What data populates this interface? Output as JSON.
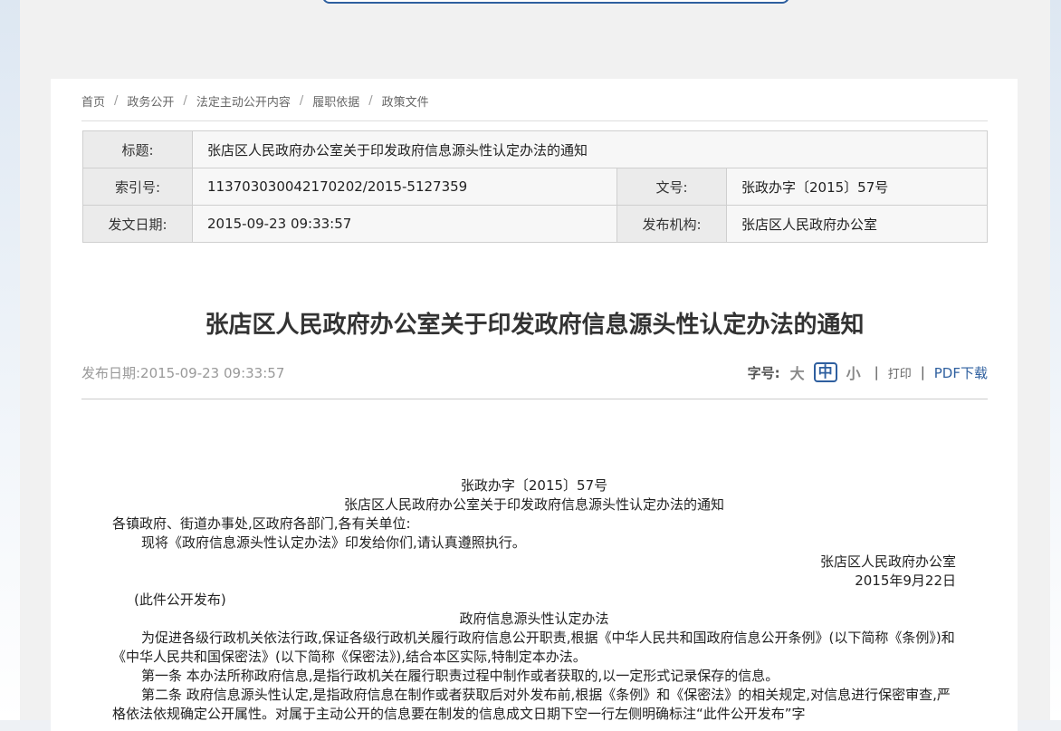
{
  "breadcrumb": [
    "首页",
    "政务公开",
    "法定主动公开内容",
    "履职依据",
    "政策文件"
  ],
  "breadcrumb_separator": "/",
  "meta": {
    "title_label": "标题:",
    "title_value": "张店区人民政府办公室关于印发政府信息源头性认定办法的通知",
    "index_label": "索引号:",
    "index_value": "11370303004217020​2/2015-5127359",
    "docno_label": "文号:",
    "docno_value": "张政办字〔2015〕57号",
    "date_label": "发文日期:",
    "date_value": "2015-09-23 09:33:57",
    "org_label": "发布机构:",
    "org_value": "张店区人民政府办公室"
  },
  "article": {
    "title": "张店区人民政府办公室关于印发政府信息源头性认定办法的通知",
    "pub_date": "发布日期:2015-09-23 09:33:57"
  },
  "tools": {
    "font_size_label": "字号:",
    "large": "大",
    "medium": "中",
    "small": "小",
    "bar": "|",
    "print": "打印",
    "pdf": "PDF下载"
  },
  "body": {
    "doc_no": "张政办字〔2015〕57号",
    "doc_title": "张店区人民政府办公室关于印发政府信息源头性认定办法的通知",
    "recipients": "各镇政府、街道办事处,区政府各部门,各有关单位:",
    "instruction": "现将《政府信息源头性认定办法》印发给你们,请认真遵照执行。",
    "signer": "张店区人民政府办公室",
    "sign_date": "2015年9月22日",
    "public_note": "(此件公开发布)",
    "measure_title": "政府信息源头性认定办法",
    "para1": "为促进各级行政机关依法行政,保证各级行政机关履行政府信息公开职责,根据《中华人民共和国政府信息公开条例》(以下简称《条例》)和《中华人民共和国保密法》(以下简称《保密法》),结合本区实际,特制定本办法。",
    "para2": "第一条 本办法所称政府信息,是指行政机关在履行职责过程中制作或者获取的,以一定形式记录保存的信息。",
    "para3": "第二条 政府信息源头性认定,是指政府信息在制作或者获取后对外发布前,根据《条例》和《保密法》的相关规定,对信息进行保密审查,严格依法依规确定公开属性。对属于主动公开的信息要在制发的信息成文日期下空一行左侧明确标注“此件公开发布”字"
  }
}
